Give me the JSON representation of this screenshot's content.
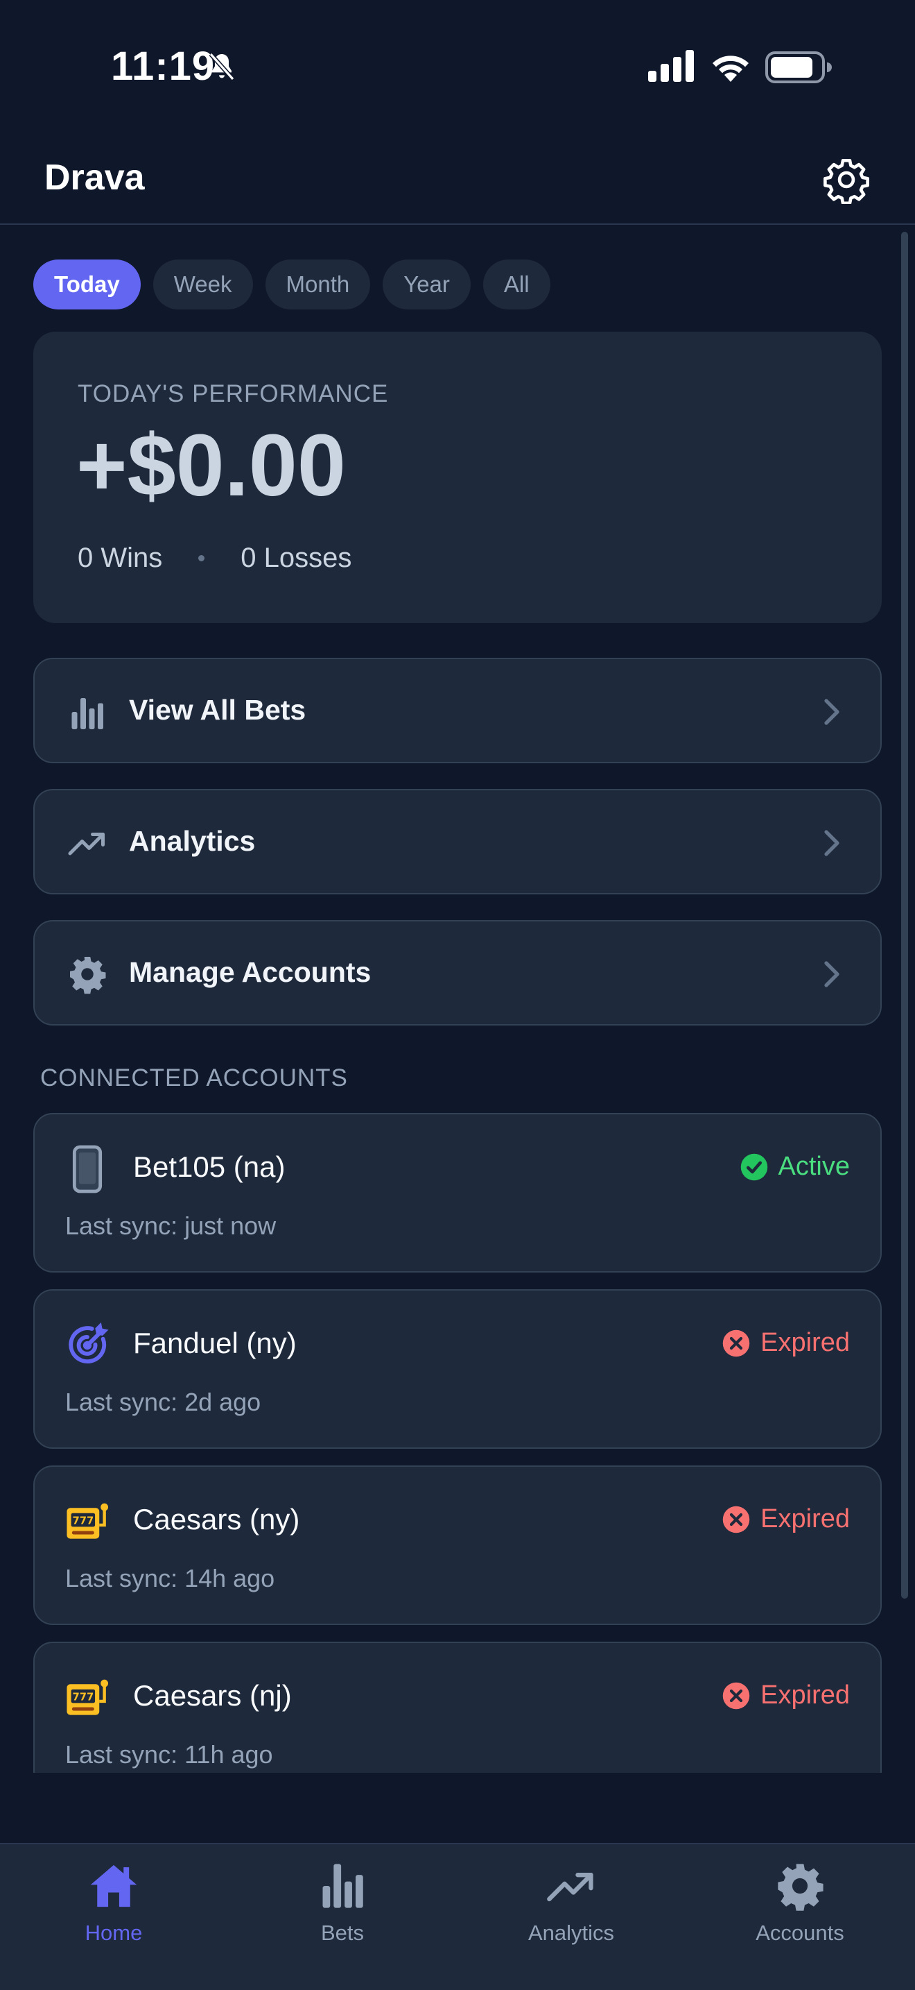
{
  "status_bar": {
    "time": "11:19"
  },
  "header": {
    "title": "Drava"
  },
  "tabs": [
    {
      "label": "Today",
      "active": true
    },
    {
      "label": "Week",
      "active": false
    },
    {
      "label": "Month",
      "active": false
    },
    {
      "label": "Year",
      "active": false
    },
    {
      "label": "All",
      "active": false
    }
  ],
  "performance": {
    "label": "TODAY'S PERFORMANCE",
    "value": "+$0.00",
    "wins": "0 Wins",
    "losses": "0 Losses"
  },
  "actions": [
    {
      "label": "View All Bets",
      "icon": "bar-chart-icon"
    },
    {
      "label": "Analytics",
      "icon": "trending-up-icon"
    },
    {
      "label": "Manage Accounts",
      "icon": "gear-icon"
    }
  ],
  "connected": {
    "section_label": "CONNECTED ACCOUNTS",
    "accounts": [
      {
        "name": "Bet105 (na)",
        "sync": "Last sync: just now",
        "status": "Active",
        "icon": "phone-icon"
      },
      {
        "name": "Fanduel (ny)",
        "sync": "Last sync: 2d ago",
        "status": "Expired",
        "icon": "target-icon"
      },
      {
        "name": "Caesars (ny)",
        "sync": "Last sync: 14h ago",
        "status": "Expired",
        "icon": "slot-machine-icon"
      },
      {
        "name": "Caesars (nj)",
        "sync": "Last sync: 11h ago",
        "status": "Expired",
        "icon": "slot-machine-icon"
      }
    ]
  },
  "bottom_nav": [
    {
      "label": "Home",
      "icon": "home-icon",
      "active": true
    },
    {
      "label": "Bets",
      "icon": "bar-chart-icon",
      "active": false
    },
    {
      "label": "Analytics",
      "icon": "trending-up-icon",
      "active": false
    },
    {
      "label": "Accounts",
      "icon": "gear-icon",
      "active": false
    }
  ],
  "colors": {
    "accent": "#6366f1",
    "active": "#4ade80",
    "expired": "#f87171",
    "background": "#0f172a",
    "card": "#1e293b"
  }
}
